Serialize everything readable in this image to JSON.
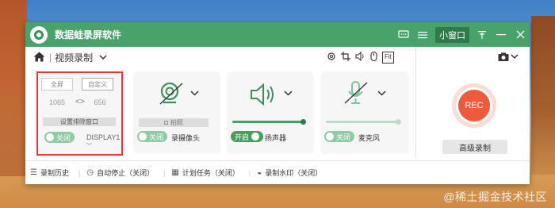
{
  "app": {
    "title": "数据蛙录屏软件",
    "mini_window": "小窗口"
  },
  "toolbar": {
    "mode_label": "视频录制",
    "separator": "|",
    "fit_label": "Fit"
  },
  "screen": {
    "full_label": "全屏",
    "custom_label": "自定义",
    "width": "1065",
    "height": "656",
    "exclude_window_label": "设置排除窗口",
    "toggle_label": "关闭",
    "display_label": "DISPLAY1"
  },
  "camera": {
    "photo_label": "拍照",
    "toggle_label": "关闭",
    "name": "录摄像头"
  },
  "speaker": {
    "toggle_label": "开启",
    "name": "扬声器",
    "volume": 1.0
  },
  "mic": {
    "toggle_label": "关闭",
    "name": "麦克风",
    "volume": 1.0
  },
  "record": {
    "rec_label": "REC",
    "advanced_label": "高级录制"
  },
  "status": {
    "history": "录制历史",
    "auto_stop": "自动停止（关闭）",
    "schedule": "计划任务（关闭）",
    "watermark": "录制水印（关闭）"
  },
  "desktop": {
    "watermark_text": "@稀土掘金技术社区"
  },
  "colors": {
    "brand": "#4aa26b",
    "rec": "#ee5a3c",
    "highlight": "#e53935"
  }
}
